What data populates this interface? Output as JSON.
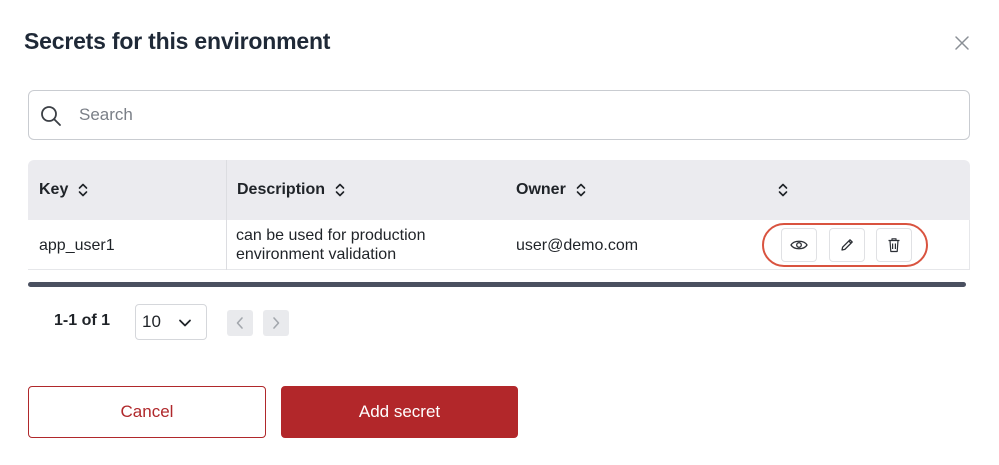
{
  "dialog": {
    "title": "Secrets for this environment"
  },
  "search": {
    "placeholder": "Search",
    "value": ""
  },
  "table": {
    "columns": [
      {
        "label": "Key"
      },
      {
        "label": "Description"
      },
      {
        "label": "Owner"
      },
      {
        "label": ""
      }
    ],
    "rows": [
      {
        "key": "app_user1",
        "description_line1": "can be used for production",
        "description_line2": "environment validation",
        "owner": "user@demo.com",
        "actions": [
          "view-icon",
          "edit-icon",
          "delete-icon"
        ]
      }
    ]
  },
  "pagination": {
    "range": "1-1 of 1",
    "page_size": "10"
  },
  "footer": {
    "cancel_label": "Cancel",
    "add_label": "Add secret"
  },
  "colors": {
    "primary": "#b2272a",
    "highlight": "#d9533f",
    "header_bg": "#ebebef",
    "scrollbar": "#4a5060"
  }
}
